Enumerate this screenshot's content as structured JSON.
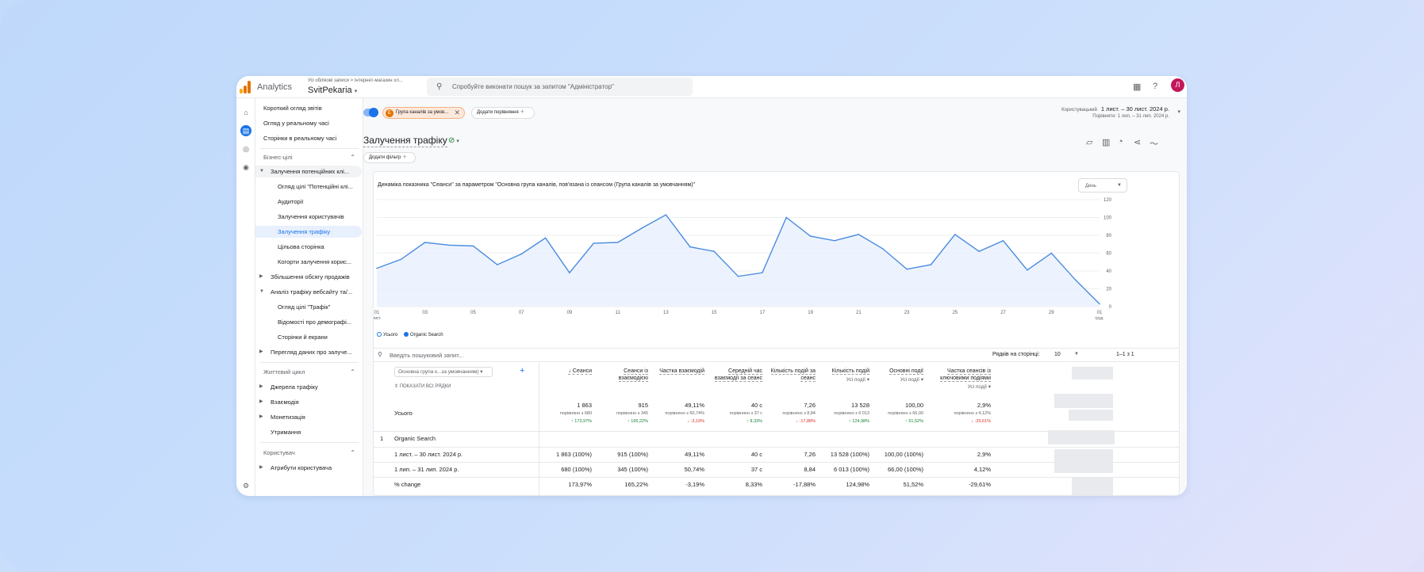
{
  "topbar": {
    "brand": "Analytics",
    "breadcrumb": "Усі облікові записи > Інтернет-магазин хл...",
    "property": "SvitPekaria",
    "search_placeholder": "Спробуйте виконати пошук за запитом \"Адміністратор\"",
    "avatar_letter": "Л"
  },
  "sidebar": {
    "top_items": [
      "Короткий огляд звітів",
      "Огляд у реальному часі",
      "Сторінки в реальному часі"
    ],
    "section1": "Бізнес-цілі",
    "group1": "Залучення потенційних клі...",
    "group1_items": [
      "Огляд цілі \"Потенційні клі...",
      "Аудиторії",
      "Залучення користувачів",
      "Залучення трафіку",
      "Цільова сторінка",
      "Когорти залучення корис..."
    ],
    "group2": "Збільшення обсягу продажів",
    "group3": "Аналіз трафіку вебсайту та/...",
    "group3_items": [
      "Огляд цілі \"Трафік\"",
      "Відомості про демографі...",
      "Сторінки й екрани"
    ],
    "group4": "Перегляд даних про залуче...",
    "section2": "Життєвий цикл",
    "lifecycle": [
      "Джерела трафіку",
      "Взаємодія",
      "Монетизація",
      "Утримання"
    ],
    "section3": "Користувач",
    "user_items": [
      "Атрибути користувача"
    ]
  },
  "filters": {
    "chip_label": "Група каналів за умов...",
    "chip_badge": "Е",
    "compare_label": "Додати порівняння"
  },
  "daterange": {
    "label": "Користувацький",
    "range": "1 лист. – 30 лист. 2024 р.",
    "compare": "Порівняти: 1 лип. – 31 лип. 2024 р."
  },
  "page": {
    "title": "Залучення трафіку",
    "add_filter": "Додати фільтр"
  },
  "chart_card": {
    "title": "Динаміка показника \"Сеанси\" за параметром \"Основна група каналів, пов'язана із сеансом (Група каналів за умовчанням)\"",
    "granularity": "День"
  },
  "chart_data": {
    "type": "area",
    "x": [
      "01",
      "02",
      "03",
      "04",
      "05",
      "06",
      "07",
      "08",
      "09",
      "10",
      "11",
      "12",
      "13",
      "14",
      "15",
      "16",
      "17",
      "18",
      "19",
      "20",
      "21",
      "22",
      "23",
      "24",
      "25",
      "26",
      "27",
      "28",
      "29",
      "30",
      "01"
    ],
    "x_tick_labels": [
      "01\nлист.",
      "03",
      "05",
      "07",
      "09",
      "11",
      "13",
      "15",
      "17",
      "19",
      "21",
      "23",
      "25",
      "27",
      "29",
      "01\nгруд."
    ],
    "ylim": [
      0,
      120
    ],
    "y_ticks": [
      0,
      20,
      40,
      60,
      80,
      100,
      120
    ],
    "series": [
      {
        "name": "Organic Search",
        "values": [
          43,
          53,
          72,
          69,
          68,
          47,
          59,
          77,
          38,
          71,
          72,
          88,
          103,
          67,
          62,
          34,
          38,
          100,
          79,
          74,
          81,
          65,
          42,
          47,
          81,
          62,
          74,
          41,
          60,
          30,
          3
        ]
      }
    ],
    "legend": [
      "Усього",
      "Organic Search"
    ],
    "legend_position": "bottom-left",
    "color": "#4a8be0"
  },
  "table": {
    "search_placeholder": "Введіть пошуковий запит...",
    "rows_per_page_label": "Рядків на сторінці:",
    "rows_per_page": "10",
    "pagination": "1–1 з 1",
    "dimension": "Основна група к...за умовчанням)",
    "show_all": "ПОКАЗАТИ ВСІ РЯДКИ",
    "total_label": "Усього",
    "columns": [
      {
        "label": "Сеанси",
        "sub": "",
        "total": "1 863",
        "cmp": "порівняно з 680",
        "pct": "↑ 173,97%",
        "dir": "up"
      },
      {
        "label": "Сеанси із взаємодією",
        "sub": "",
        "total": "915",
        "cmp": "порівняно з 345",
        "pct": "↑ 165,22%",
        "dir": "up"
      },
      {
        "label": "Частка взаємодій",
        "sub": "",
        "total": "49,11%",
        "cmp": "порівняно з 50,74%",
        "pct": "↓ -3,19%",
        "dir": "dn"
      },
      {
        "label": "Середній час взаємодії за сеанс",
        "sub": "",
        "total": "40 с",
        "cmp": "порівняно з 37 с",
        "pct": "↑ 8,33%",
        "dir": "up"
      },
      {
        "label": "Кількість подій за сеанс",
        "sub": "",
        "total": "7,26",
        "cmp": "порівняно з 8,84",
        "pct": "↓ -17,88%",
        "dir": "dn"
      },
      {
        "label": "Кількість подій",
        "sub": "Усі події",
        "total": "13 528",
        "cmp": "порівняно з 6 013",
        "pct": "↑ 124,98%",
        "dir": "up"
      },
      {
        "label": "Основні події",
        "sub": "Усі події",
        "total": "100,00",
        "cmp": "порівняно з 66,00",
        "pct": "↑ 51,52%",
        "dir": "up"
      },
      {
        "label": "Частка сеансів із ключовими подіями",
        "sub": "Усі події",
        "total": "2,9%",
        "cmp": "порівняно з 4,12%",
        "pct": "↓ -29,61%",
        "dir": "dn"
      }
    ],
    "group_index": "1",
    "group_label": "Organic Search",
    "rows": [
      {
        "label": "1 лист. – 30 лист. 2024 р.",
        "cells": [
          "1 863 (100%)",
          "915 (100%)",
          "49,11%",
          "40 с",
          "7,26",
          "13 528 (100%)",
          "100,00 (100%)",
          "2,9%"
        ]
      },
      {
        "label": "1 лип. – 31 лип. 2024 р.",
        "cells": [
          "680 (100%)",
          "345 (100%)",
          "50,74%",
          "37 с",
          "8,84",
          "6 013 (100%)",
          "66,00 (100%)",
          "4,12%"
        ]
      },
      {
        "label": "% change",
        "cells": [
          "173,97%",
          "165,22%",
          "-3,19%",
          "8,33%",
          "-17,88%",
          "124,98%",
          "51,52%",
          "-29,61%"
        ]
      }
    ]
  }
}
